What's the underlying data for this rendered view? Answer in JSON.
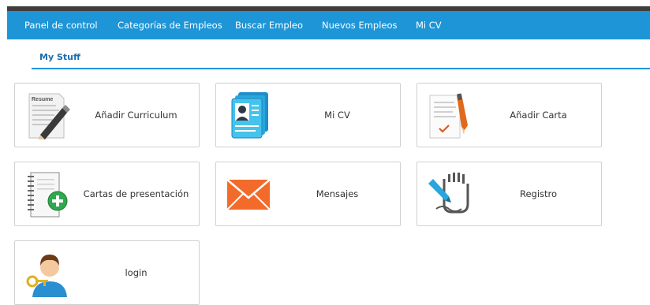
{
  "nav": {
    "items": [
      "Panel de control",
      "Categorías de Empleos",
      "Buscar Empleo",
      "Nuevos Empleos",
      "Mi CV"
    ]
  },
  "tabs": {
    "my_stuff": "My Stuff"
  },
  "cards": [
    {
      "label": "Añadir Curriculum",
      "icon": "resume-edit-icon"
    },
    {
      "label": "Mi CV",
      "icon": "profile-card-icon"
    },
    {
      "label": "Añadir Carta",
      "icon": "letter-pen-icon"
    },
    {
      "label": "Cartas de presentación",
      "icon": "notebook-add-icon"
    },
    {
      "label": "Mensajes",
      "icon": "envelope-icon"
    },
    {
      "label": "Registro",
      "icon": "signature-hand-icon"
    },
    {
      "label": "login",
      "icon": "user-key-icon"
    }
  ],
  "resume_icon_text": "Resume",
  "colors": {
    "nav_bg": "#1e95d6",
    "top_strip": "#3e3e3e",
    "tab_text": "#1c6fb0",
    "card_border": "#d0d0d0"
  }
}
